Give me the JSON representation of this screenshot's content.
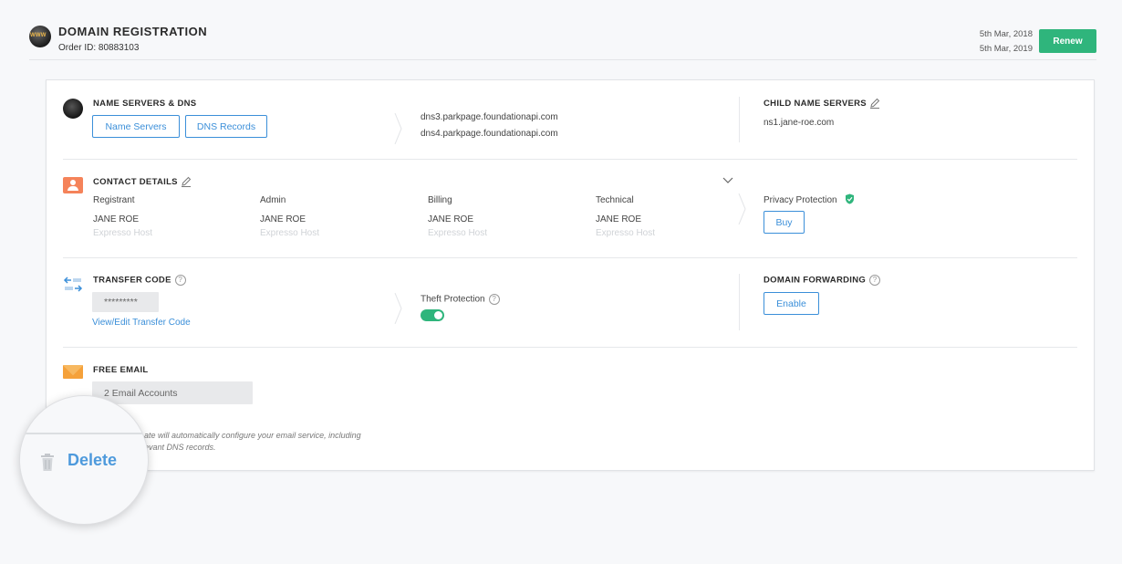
{
  "header": {
    "globe_label": "WWW",
    "title": "DOMAIN REGISTRATION",
    "order_id": "Order ID: 80883103",
    "date_start": "5th Mar, 2018",
    "date_end": "5th Mar, 2019",
    "renew_label": "Renew"
  },
  "name_servers": {
    "title": "NAME SERVERS & DNS",
    "btn_name_servers": "Name Servers",
    "btn_dns_records": "DNS Records",
    "ns_list": [
      "dns3.parkpage.foundationapi.com",
      "dns4.parkpage.foundationapi.com"
    ],
    "child_title": "CHILD NAME SERVERS",
    "child_value": "ns1.jane-roe.com"
  },
  "contact": {
    "title": "CONTACT DETAILS",
    "columns": [
      {
        "role": "Registrant",
        "name": "JANE ROE",
        "org": "Expresso Host"
      },
      {
        "role": "Admin",
        "name": "JANE ROE",
        "org": "Expresso Host"
      },
      {
        "role": "Billing",
        "name": "JANE ROE",
        "org": "Expresso Host"
      },
      {
        "role": "Technical",
        "name": "JANE ROE",
        "org": "Expresso Host"
      }
    ],
    "privacy_label": "Privacy Protection",
    "buy_label": "Buy"
  },
  "transfer": {
    "title": "TRANSFER CODE",
    "masked_code": "*********",
    "view_edit_link": "View/Edit Transfer Code",
    "theft_label": "Theft Protection",
    "theft_on": true,
    "forwarding_title": "DOMAIN FORWARDING",
    "enable_label": "Enable"
  },
  "email": {
    "title": "FREE EMAIL",
    "accounts_value": "2 Email Accounts",
    "note_line1": "ate will automatically configure your email service, including",
    "note_line2": "evant DNS records."
  },
  "magnifier": {
    "delete_label": "Delete"
  },
  "colors": {
    "accent": "#3b8fd9",
    "renew_green": "#2fb57c",
    "contact_orange": "#f5835a",
    "mail_orange": "#f5a13a"
  }
}
